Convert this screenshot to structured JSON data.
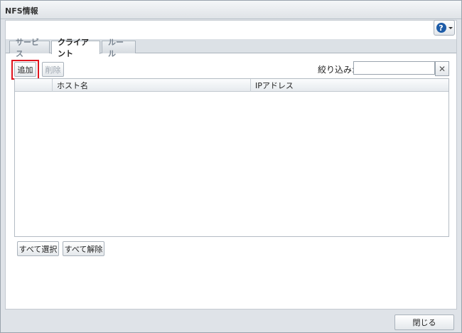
{
  "window": {
    "title": "NFS情報"
  },
  "help": {
    "icon": "help-icon"
  },
  "tabs": [
    {
      "label": "サービス",
      "active": false
    },
    {
      "label": "クライアント",
      "active": true
    },
    {
      "label": "ルール",
      "active": false
    }
  ],
  "toolbar": {
    "add_label": "追加",
    "delete_label": "削除",
    "filter_label": "絞り込み:",
    "filter_value": ""
  },
  "grid": {
    "columns": [
      "",
      "ホスト名",
      "IPアドレス"
    ],
    "rows": []
  },
  "selection": {
    "select_all_label": "すべて選択",
    "deselect_all_label": "すべて解除"
  },
  "footer": {
    "close_label": "閉じる"
  },
  "colors": {
    "highlight": "#e0141e",
    "help_blue": "#1d5ca8"
  }
}
